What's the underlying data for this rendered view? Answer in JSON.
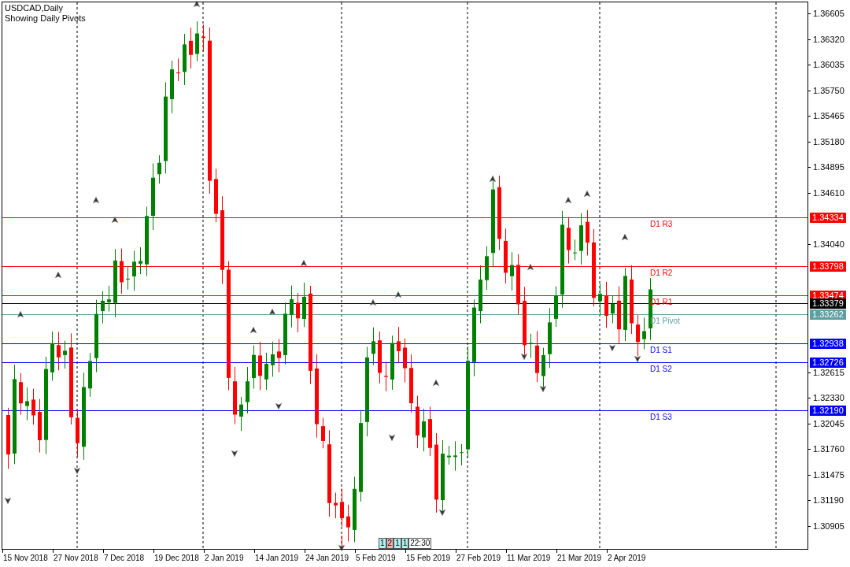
{
  "chart": {
    "title": "USDCAD,Daily",
    "subtitle": "Showing Daily Pivots",
    "price_ticks": [
      "1.36605",
      "1.36320",
      "1.36035",
      "1.35750",
      "1.35465",
      "1.35180",
      "1.34895",
      "1.34610",
      "1.34040",
      "1.32615",
      "1.32330",
      "1.32045",
      "1.31760",
      "1.31475",
      "1.31190",
      "1.30905"
    ],
    "date_ticks": [
      "15 Nov 2018",
      "27 Nov 2018",
      "7 Dec 2018",
      "19 Dec 2018",
      "2 Jan 2019",
      "14 Jan 2019",
      "24 Jan 2019",
      "5 Feb 2019",
      "15 Feb 2019",
      "27 Feb 2019",
      "11 Mar 2019",
      "21 Mar 2019",
      "2 Apr 2019"
    ],
    "levels": [
      {
        "kind": "pivot",
        "label": "D1 R3",
        "price": "1.34334",
        "color": "#ff0000"
      },
      {
        "kind": "pivot",
        "label": "D1 R2",
        "price": "1.33798",
        "color": "#ff0000"
      },
      {
        "kind": "pivot",
        "label": "D1 R1",
        "price": "1.33474",
        "color": "#ff0000"
      },
      {
        "kind": "current",
        "price": "1.33379",
        "color": "#000000"
      },
      {
        "kind": "pivot",
        "label": "D1 Pivot",
        "price": "1.33262",
        "color": "#5f9ea0"
      },
      {
        "kind": "pivot",
        "label": "D1 S1",
        "price": "1.32938",
        "color": "#0000ff"
      },
      {
        "kind": "pivot",
        "label": "D1 S2",
        "price": "1.32726",
        "color": "#0000ff"
      },
      {
        "kind": "pivot",
        "label": "D1 S3",
        "price": "1.32190",
        "color": "#0000ff"
      }
    ],
    "timer": [
      {
        "text": "1",
        "color": "#b4f0f0"
      },
      {
        "text": "2",
        "color": "#f0b4b4"
      },
      {
        "text": "1",
        "color": "#b4f0f0"
      },
      {
        "text": "1",
        "color": "#b4f0f0"
      },
      {
        "text": "22:30",
        "color": "#ffffff"
      }
    ]
  }
}
